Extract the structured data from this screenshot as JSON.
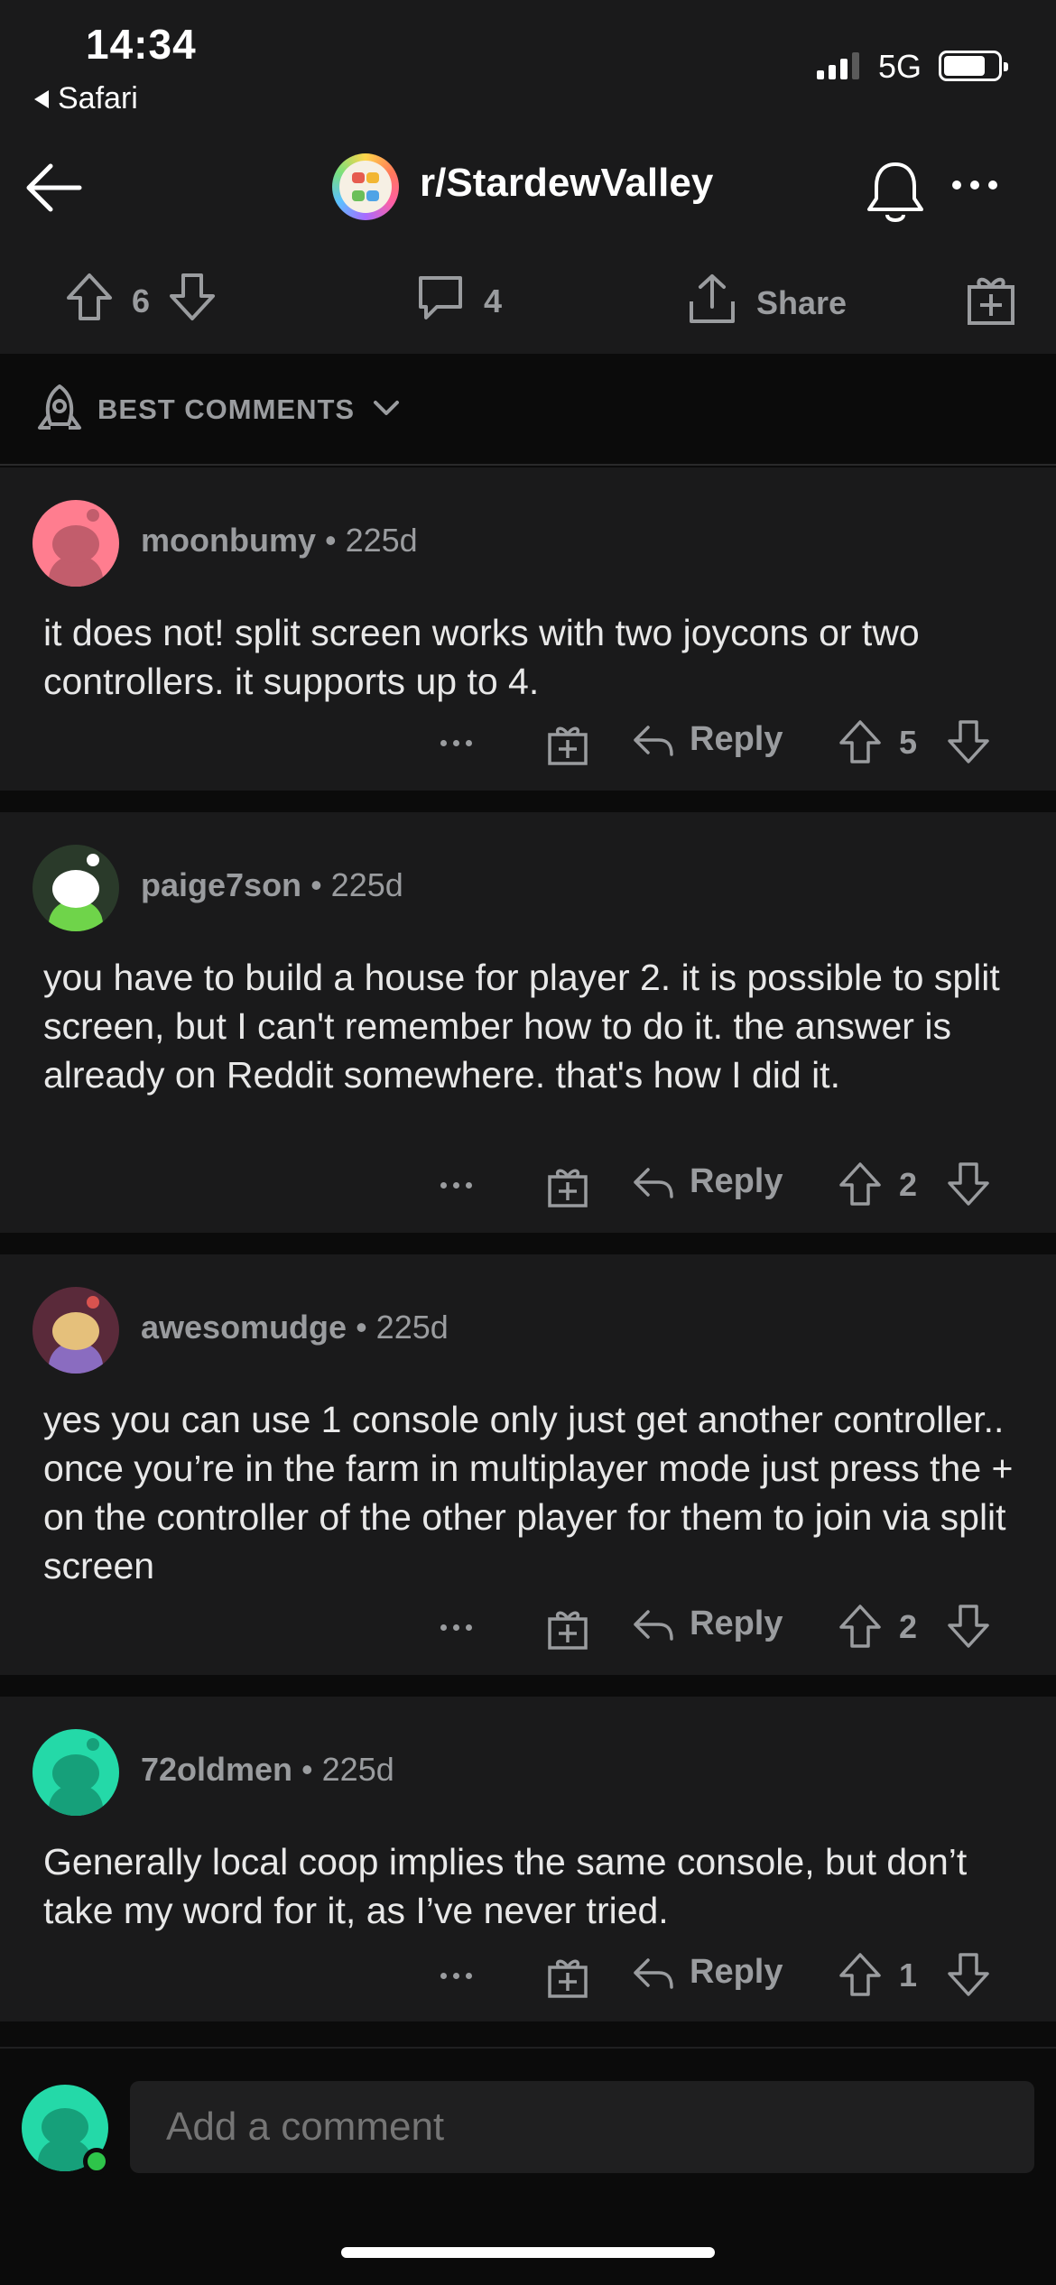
{
  "status": {
    "time": "14:34",
    "back_app": "Safari",
    "network": "5G"
  },
  "header": {
    "subreddit": "r/StardewValley"
  },
  "post_actions": {
    "score": "6",
    "comments": "4",
    "share": "Share"
  },
  "sort": {
    "label": "BEST COMMENTS"
  },
  "comments": [
    {
      "user": "moonbumy",
      "age": "225d",
      "text": "it does not! split screen works with two joycons or two controllers. it supports up to 4.",
      "reply": "Reply",
      "score": "5"
    },
    {
      "user": "paige7son",
      "age": "225d",
      "text": "you have to build a house for player 2. it is possible to split screen, but I can't remember how to do it. the answer is already on Reddit somewhere. that's how I did it.",
      "reply": "Reply",
      "score": "2"
    },
    {
      "user": "awesomudge",
      "age": "225d",
      "text": "yes you can use 1 console only just get another controller.. once you’re in the farm in multiplayer mode just press the + on the controller of the other player for them to join via split screen",
      "reply": "Reply",
      "score": "2"
    },
    {
      "user": "72oldmen",
      "age": "225d",
      "text": "Generally local coop implies the same console, but don’t take my word for it, as I’ve never tried.",
      "reply": "Reply",
      "score": "1"
    }
  ],
  "composer": {
    "placeholder": "Add a comment"
  },
  "colors": {
    "background": "#0b0b0b",
    "card": "#1a1a1b",
    "muted_text": "#9a9c9f",
    "online": "#2ec44a"
  }
}
